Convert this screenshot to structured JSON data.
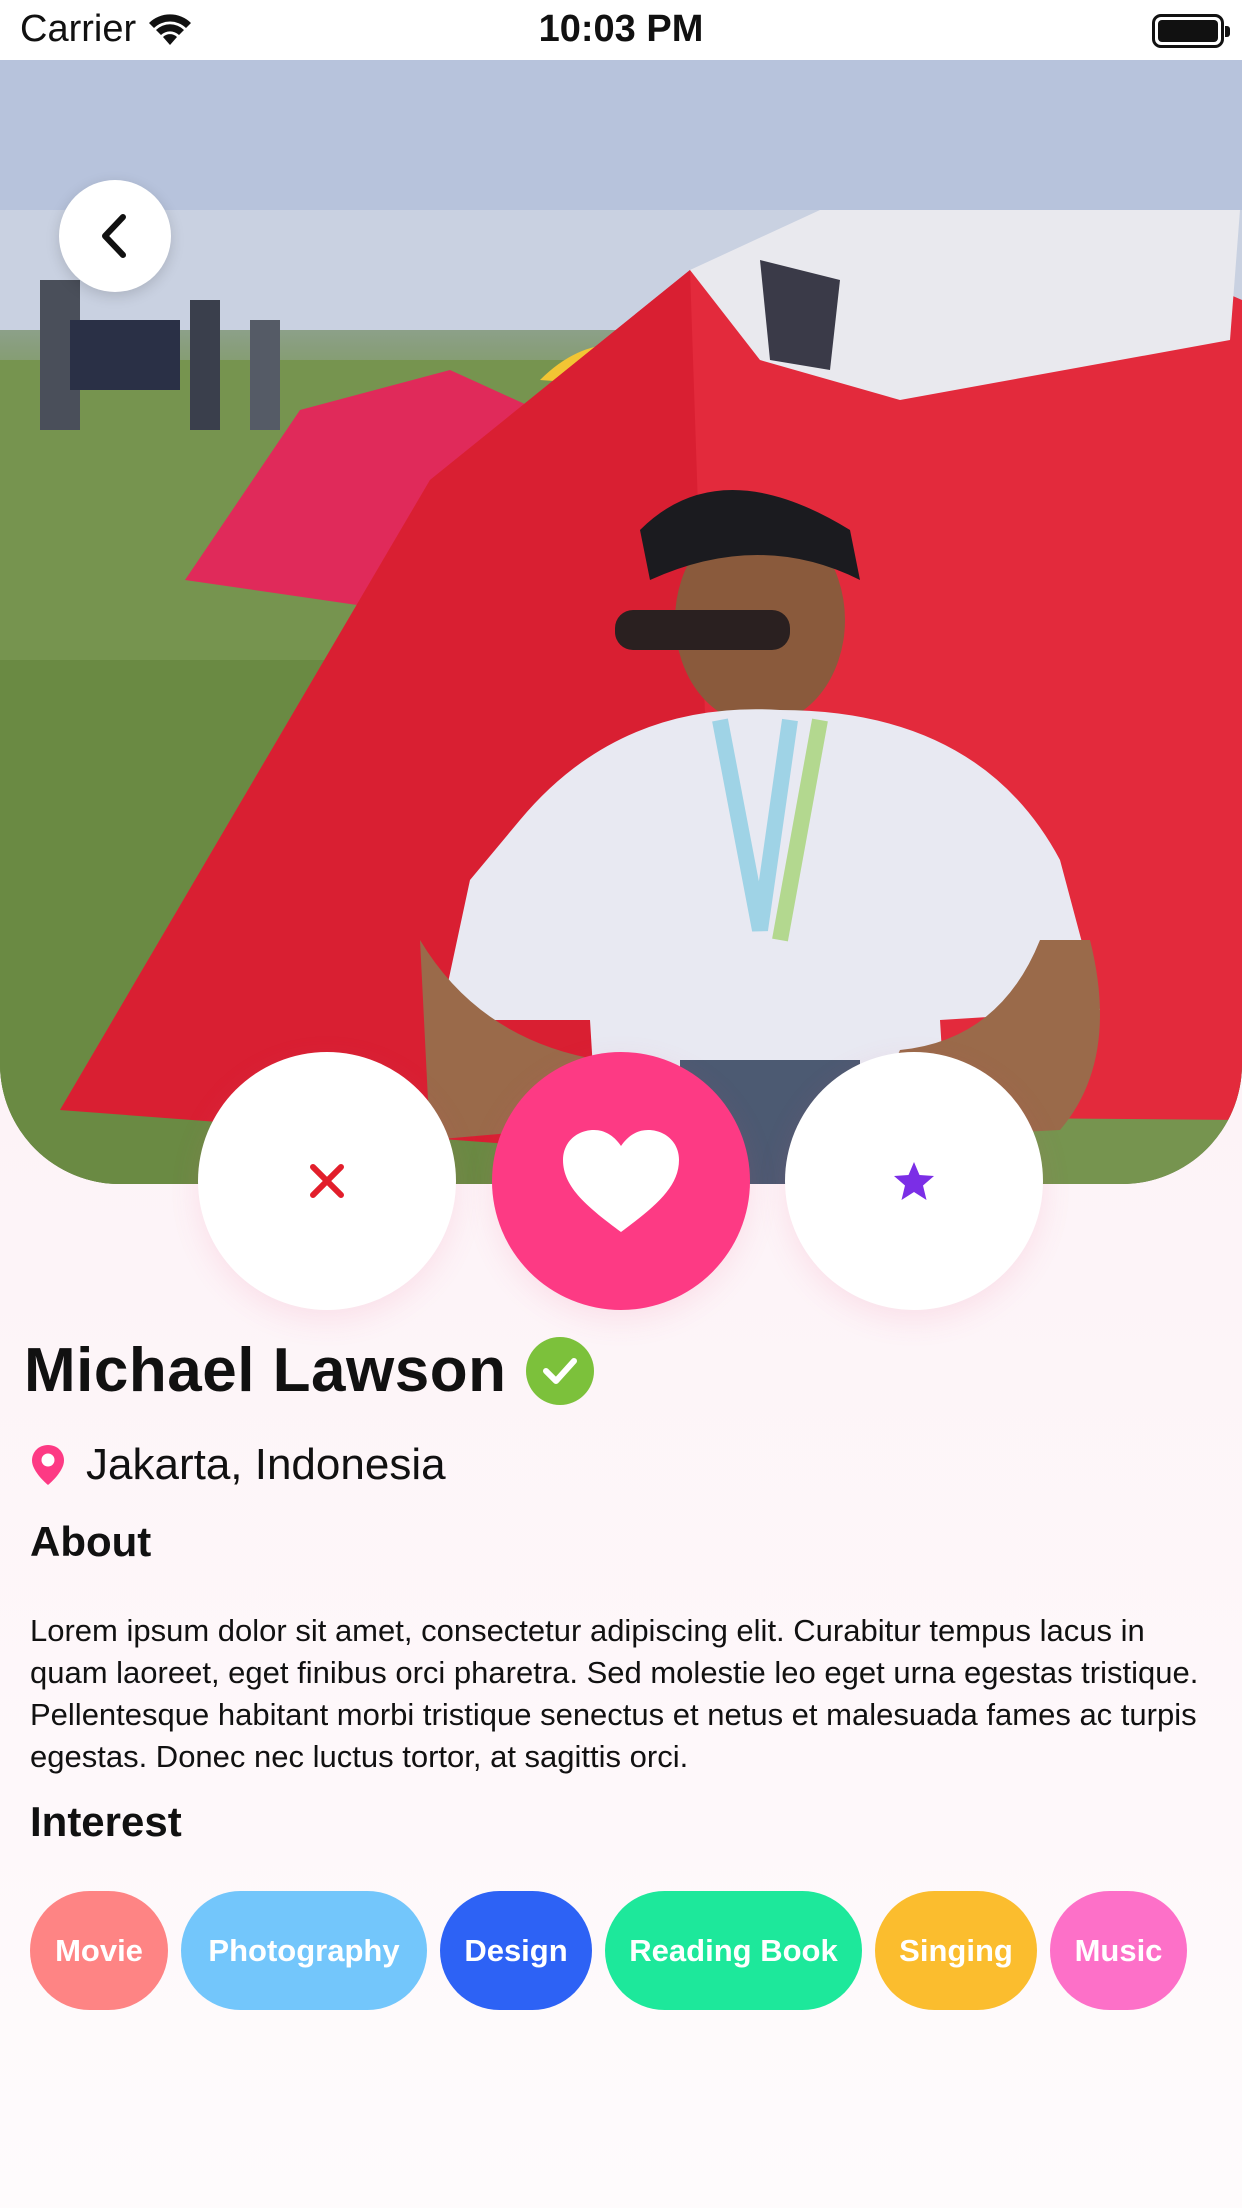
{
  "status_bar": {
    "carrier": "Carrier",
    "time": "10:03 PM",
    "icons": [
      "wifi-icon",
      "battery-icon"
    ]
  },
  "profile": {
    "photo": "camping tents on grass field, man in white t-shirt and sunglasses sitting in front of red tent",
    "name": "Michael Lawson",
    "verified": true,
    "location": "Jakarta, Indonesia"
  },
  "actions": {
    "dislike_icon": "close-icon",
    "like_icon": "heart-icon",
    "super_icon": "star-icon"
  },
  "about": {
    "title": "About",
    "text": "Lorem ipsum dolor sit amet, consectetur adipiscing elit. Curabitur tempus lacus in quam laoreet, eget finibus orci pharetra. Sed molestie leo eget urna egestas tristique. Pellentesque habitant morbi tristique senectus et netus et malesuada fames ac turpis egestas. Donec nec luctus tortor, at sagittis orci."
  },
  "interest": {
    "title": "Interest",
    "items": [
      {
        "label": "Movie",
        "color": "#fe8484"
      },
      {
        "label": "Photography",
        "color": "#73c6fb"
      },
      {
        "label": "Design",
        "color": "#2d62f5"
      },
      {
        "label": "Reading Book",
        "color": "#1de89b"
      },
      {
        "label": "Singing",
        "color": "#fbbd2e"
      },
      {
        "label": "Music",
        "color": "#fd70c8"
      }
    ]
  },
  "colors": {
    "accent": "#fd3a84",
    "verified": "#7cc13b",
    "dislike": "#e21e2b",
    "star": "#7b2ee6"
  }
}
